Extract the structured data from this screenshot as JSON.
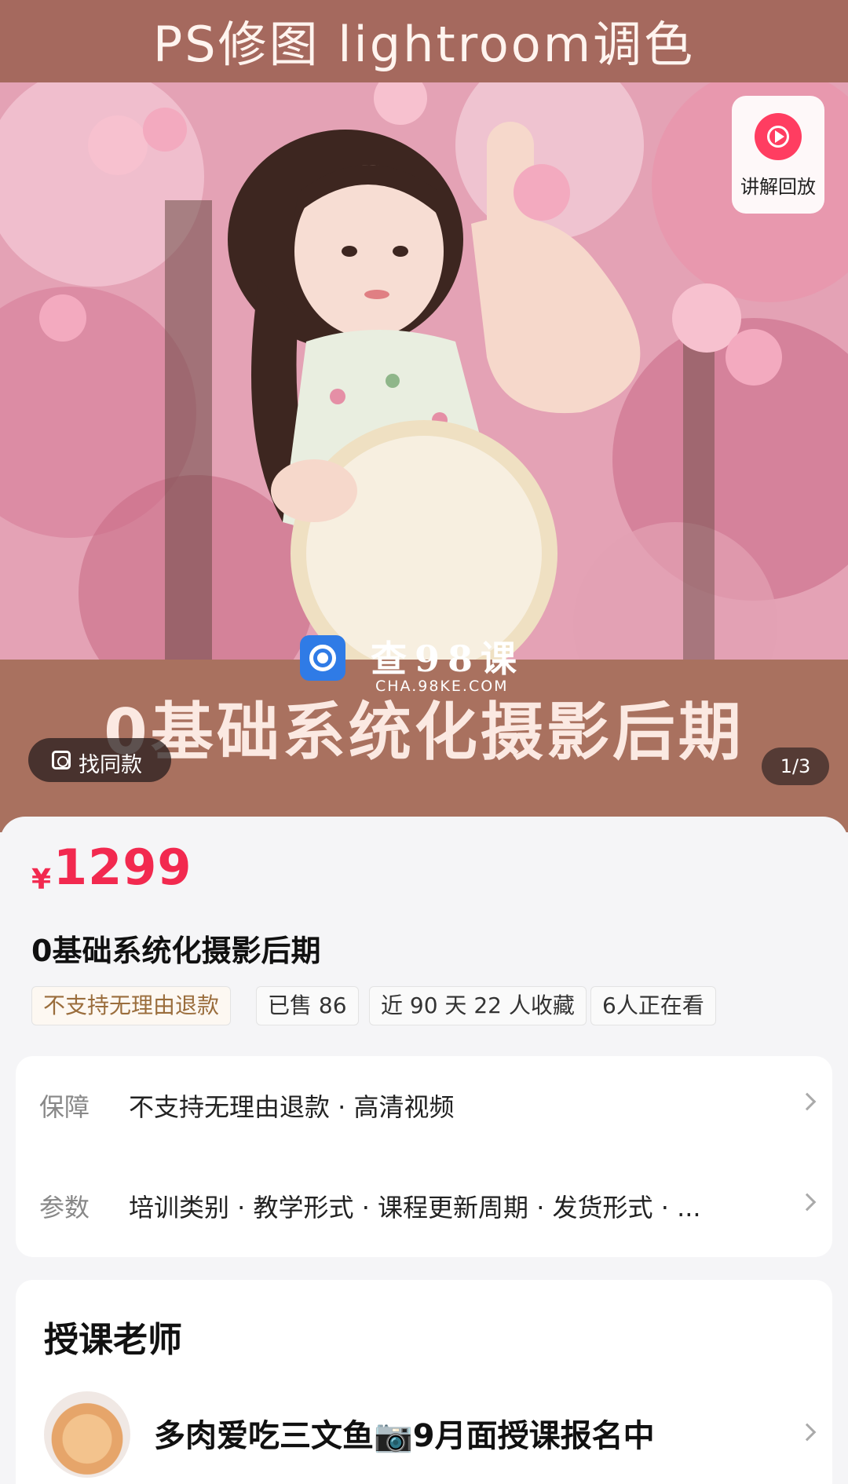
{
  "hero": {
    "top_text": "PS修图  lightroom调色",
    "bottom_text": "0基础系统化摄影后期",
    "watermark": {
      "name": "查98课",
      "url": "CHA.98KE.COM"
    },
    "replay_button": {
      "icon": "play-replay-icon",
      "label": "讲解回放"
    },
    "find_similar": {
      "icon": "scan-icon",
      "label": "找同款"
    },
    "page_indicator": "1/3"
  },
  "product": {
    "price_symbol": "¥",
    "price": "1299",
    "title": "0基础系统化摄影后期",
    "tags": [
      "不支持无理由退款",
      "已售 86",
      "近 90 天 22 人收藏",
      "6人正在看"
    ]
  },
  "guarantee": {
    "rows": [
      {
        "label": "保障",
        "value": "不支持无理由退款 · 高清视频"
      },
      {
        "label": "参数",
        "value": "培训类别 · 教学形式 · 课程更新周期 · 发货形式 · ..."
      }
    ]
  },
  "teacher": {
    "heading": "授课老师",
    "name": "多肉爱吃三文鱼📷9月面授课报名中"
  },
  "colors": {
    "price": "#f2294f",
    "band": "#a5695e",
    "replay_accent": "#ff3d61",
    "tag_brown": "#9a6d3c"
  }
}
